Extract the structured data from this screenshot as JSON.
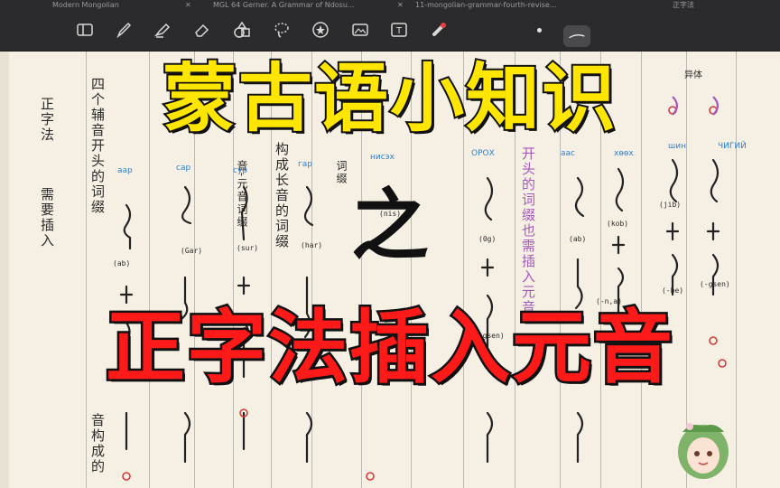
{
  "tabs": [
    {
      "label": "Modern Mongolian"
    },
    {
      "label": "MGL 64 Gerner. A Grammar of Ndosu..."
    },
    {
      "label": "11-mongolian-grammar-fourth-revise..."
    },
    {
      "label": "正字法"
    }
  ],
  "toolbar": {
    "tools": [
      "sidebar-icon",
      "pen-icon",
      "highlighter-icon",
      "eraser-icon",
      "shapes-icon",
      "lasso-icon",
      "sticker-icon",
      "image-icon",
      "text-icon",
      "laser-pointer-icon"
    ]
  },
  "notes": {
    "left_heading": "正字法",
    "left_sub": "需要插入",
    "col1": "四个辅音开头的词缀",
    "col2_bottom": "音构成的",
    "col3": "音-元音词缀",
    "col4": "构成长音的词缀",
    "col5": "词缀",
    "purple_col": "开头的词缀也需插入元音",
    "top_right": "异体",
    "cyrillic": [
      "аар",
      "сар",
      "сур",
      "гар",
      "нисэх",
      "ОРОХ",
      "аас",
      "хөөх",
      "шин",
      "ЧИГИЙ"
    ],
    "latin_labels": [
      "(ab)",
      "(Gar)",
      "(sur)",
      "(har)",
      "(nis)",
      "(0g)",
      "(ab)",
      "(kob)",
      "(jib)",
      "(-be)",
      "(-gsen)",
      "(-n,a)",
      "(-gsen)"
    ]
  },
  "overlay": {
    "line1": "蒙古语小知识",
    "connector": "之",
    "line2": "正字法插入元音"
  },
  "colors": {
    "title1": "#ffe600",
    "title2": "#ff1a1a",
    "stroke": "#111111",
    "cyrillic": "#2f7fd0",
    "purple": "#a458b8",
    "red_mark": "#d43b3b"
  }
}
